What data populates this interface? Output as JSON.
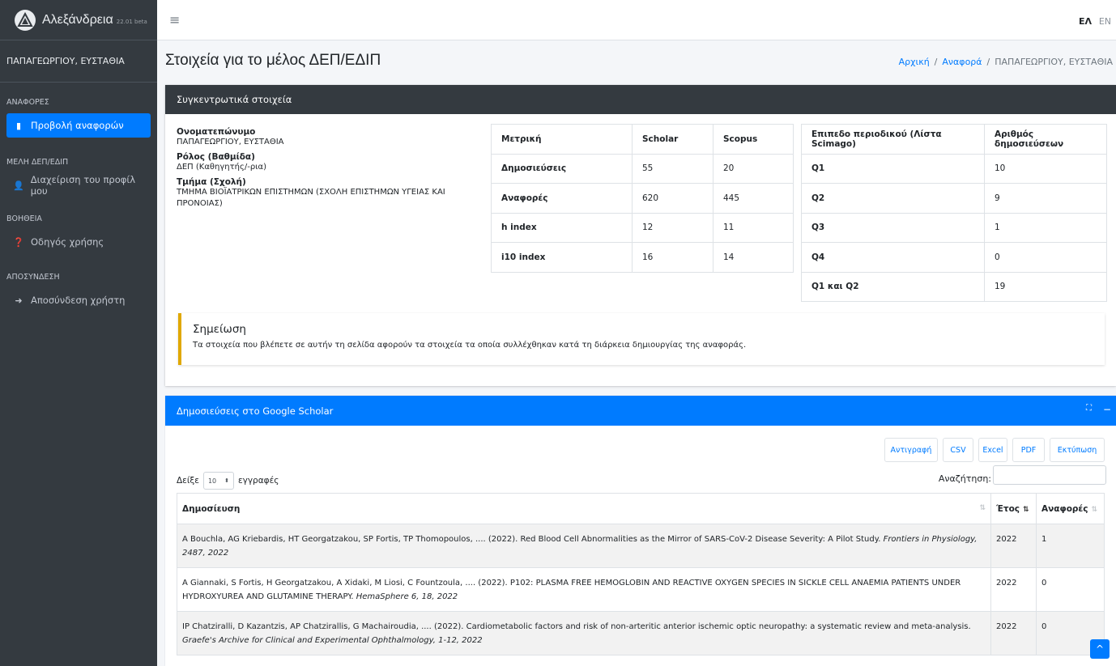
{
  "brand": {
    "name": "Αλεξάνδρεια",
    "version": "22.01 beta"
  },
  "sidebar": {
    "user": "ΠΑΠΑΓΕΩΡΓΙΟΥ, ΕΥΣΤΑΘΙΑ",
    "sec_reports": "ΑΝΑΦΟΡΕΣ",
    "view_reports": "Προβολή αναφορών",
    "sec_members": "ΜΕΛΗ ΔΕΠ/ΕΔΙΠ",
    "manage_profile": "Διαχείριση του προφίλ μου",
    "sec_help": "ΒΟΗΘΕΙΑ",
    "user_guide": "Οδηγός χρήσης",
    "sec_logout": "ΑΠΟΣΥΝΔΕΣΗ",
    "logout": "Αποσύνδεση χρήστη"
  },
  "topbar": {
    "hamburger": "≡",
    "lang_el": "ΕΛ",
    "lang_en": "EN"
  },
  "header": {
    "title": "Στοιχεία για το μέλος ΔΕΠ/ΕΔΙΠ",
    "breadcrumb": {
      "home": "Αρχική",
      "report": "Αναφορά",
      "sep": "/",
      "current": "ΠΑΠΑΓΕΩΡΓΙΟΥ, ΕΥΣΤΑΘΙΑ"
    }
  },
  "summary": {
    "title": "Συγκεντρωτικά στοιχεία",
    "name_label": "Ονοματεπώνυμο",
    "name_value": "ΠΑΠΑΓΕΩΡΓΙΟΥ, ΕΥΣΤΑΘΙΑ",
    "role_label": "Ρόλος (Βαθμίδα)",
    "role_value": "ΔΕΠ (Καθηγητής/-ρια)",
    "dept_label": "Τμήμα (Σχολή)",
    "dept_value": "ΤΜΗΜΑ ΒΙΟΪΑΤΡΙΚΩΝ ΕΠΙΣΤΗΜΩΝ (ΣΧΟΛΗ ΕΠΙΣΤΗΜΩΝ ΥΓΕΙΑΣ ΚΑΙ ΠΡΟΝΟΙΑΣ)",
    "metrics": {
      "headers": [
        "Μετρική",
        "Scholar",
        "Scopus"
      ],
      "rows": [
        [
          "Δημοσιεύσεις",
          "55",
          "20"
        ],
        [
          "Αναφορές",
          "620",
          "445"
        ],
        [
          "h index",
          "12",
          "11"
        ],
        [
          "i10 index",
          "16",
          "14"
        ]
      ]
    },
    "journals": {
      "headers": [
        "Επιπεδο περιοδικού (Λίστα Scimago)",
        "Αριθμός δημοσιεύσεων"
      ],
      "rows": [
        [
          "Q1",
          "10"
        ],
        [
          "Q2",
          "9"
        ],
        [
          "Q3",
          "1"
        ],
        [
          "Q4",
          "0"
        ],
        [
          "Q1 και Q2",
          "19"
        ]
      ]
    },
    "note_title": "Σημείωση",
    "note_text": "Τα στοιχεία που βλέπετε σε αυτήν τη σελίδα αφορούν τα στοιχεία τα οποία συλλέχθηκαν κατά τη διάρκεια δημιουργίας της αναφοράς."
  },
  "scholar": {
    "title": "Δημοσιεύσεις στο Google Scholar",
    "tools": {
      "expand": "⛶",
      "collapse": "−"
    },
    "buttons": {
      "copy": "Αντιγραφή",
      "csv": "CSV",
      "excel": "Excel",
      "pdf": "PDF",
      "print": "Εκτύπωση"
    },
    "length_prefix": "Δείξε",
    "length_value": "10",
    "length_suffix": "εγγραφές",
    "search_label": "Αναζήτηση:",
    "columns": [
      "Δημοσίευση",
      "Έτος",
      "Αναφορές"
    ],
    "rows": [
      {
        "text": "A Bouchla, AG Kriebardis, HT Georgatzakou, SP Fortis, TP Thomopoulos, .... (2022). Red Blood Cell Abnormalities as the Mirror of SARS-CoV-2 Disease Severity: A Pilot Study. ",
        "journal": "Frontiers in Physiology, 2487, 2022",
        "year": "2022",
        "citations": "1"
      },
      {
        "text": "A Giannaki, S Fortis, H Georgatzakou, A Xidaki, M Liosi, C Fountzoula, .... (2022). P102: PLASMA FREE HEMOGLOBIN AND REACTIVE OXYGEN SPECIES IN SICKLE CELL ANAEMIA PATIENTS UNDER HYDROXYUREA AND GLUTAMINE THERAPY. ",
        "journal": "HemaSphere 6, 18, 2022",
        "year": "2022",
        "citations": "0"
      },
      {
        "text": "IP Chatziralli, D Kazantzis, AP Chatzirallis, G Machairoudia, .... (2022). Cardiometabolic factors and risk of non-arteritic anterior ischemic optic neuropathy: a systematic review and meta-analysis. ",
        "journal": "Graefe's Archive for Clinical and Experimental Ophthalmology, 1-12, 2022",
        "year": "2022",
        "citations": "0"
      }
    ]
  },
  "scroll_top": "^"
}
